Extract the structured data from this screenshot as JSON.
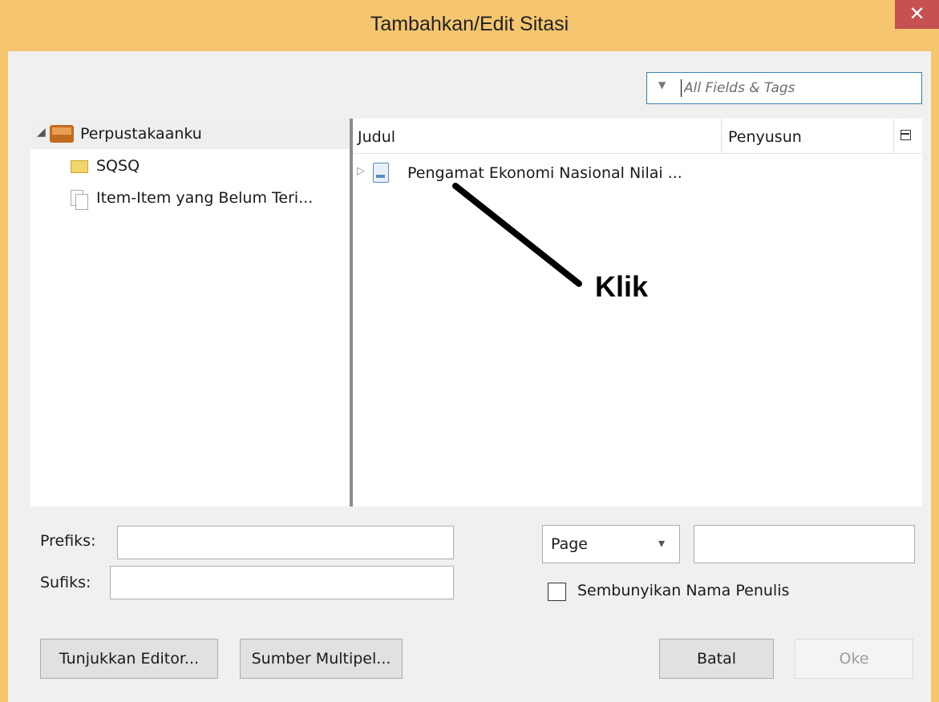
{
  "window": {
    "title": "Tambahkan/Edit Sitasi",
    "close_glyph": "✕"
  },
  "search": {
    "placeholder": "All Fields & Tags",
    "mode_glyph": "▼",
    "icon": "search-mode-dropdown-icon"
  },
  "library": {
    "root_label": "Perpustakaanku",
    "root_icon": "library-icon",
    "children": [
      {
        "label": "SQSQ",
        "icon": "folder-icon"
      },
      {
        "label": "Item-Item yang Belum Teri...",
        "icon": "unfiled-items-icon"
      }
    ]
  },
  "items_table": {
    "columns": [
      "Judul",
      "Penyusun"
    ],
    "column_picker_icon": "column-picker-icon",
    "rows": [
      {
        "title": "Pengamat Ekonomi Nasional Nilai ...",
        "author": "",
        "icon": "document-icon"
      }
    ]
  },
  "annotation": {
    "label": "Klik",
    "arrow_color": "#000000"
  },
  "form": {
    "prefix_label": "Prefiks:",
    "prefix_value": "",
    "suffix_label": "Sufiks:",
    "suffix_value": "",
    "locator_selected": "Page",
    "locator_value": "",
    "suppress_author_label": "Sembunyikan Nama Penulis",
    "suppress_author_checked": false
  },
  "buttons": {
    "show_editor": "Tunjukkan Editor...",
    "multiple_sources": "Sumber Multipel...",
    "cancel": "Batal",
    "ok": "Oke"
  },
  "colors": {
    "titlebar": "#f5c56f",
    "close_button": "#c75050",
    "accent": "#3c7fb1"
  }
}
